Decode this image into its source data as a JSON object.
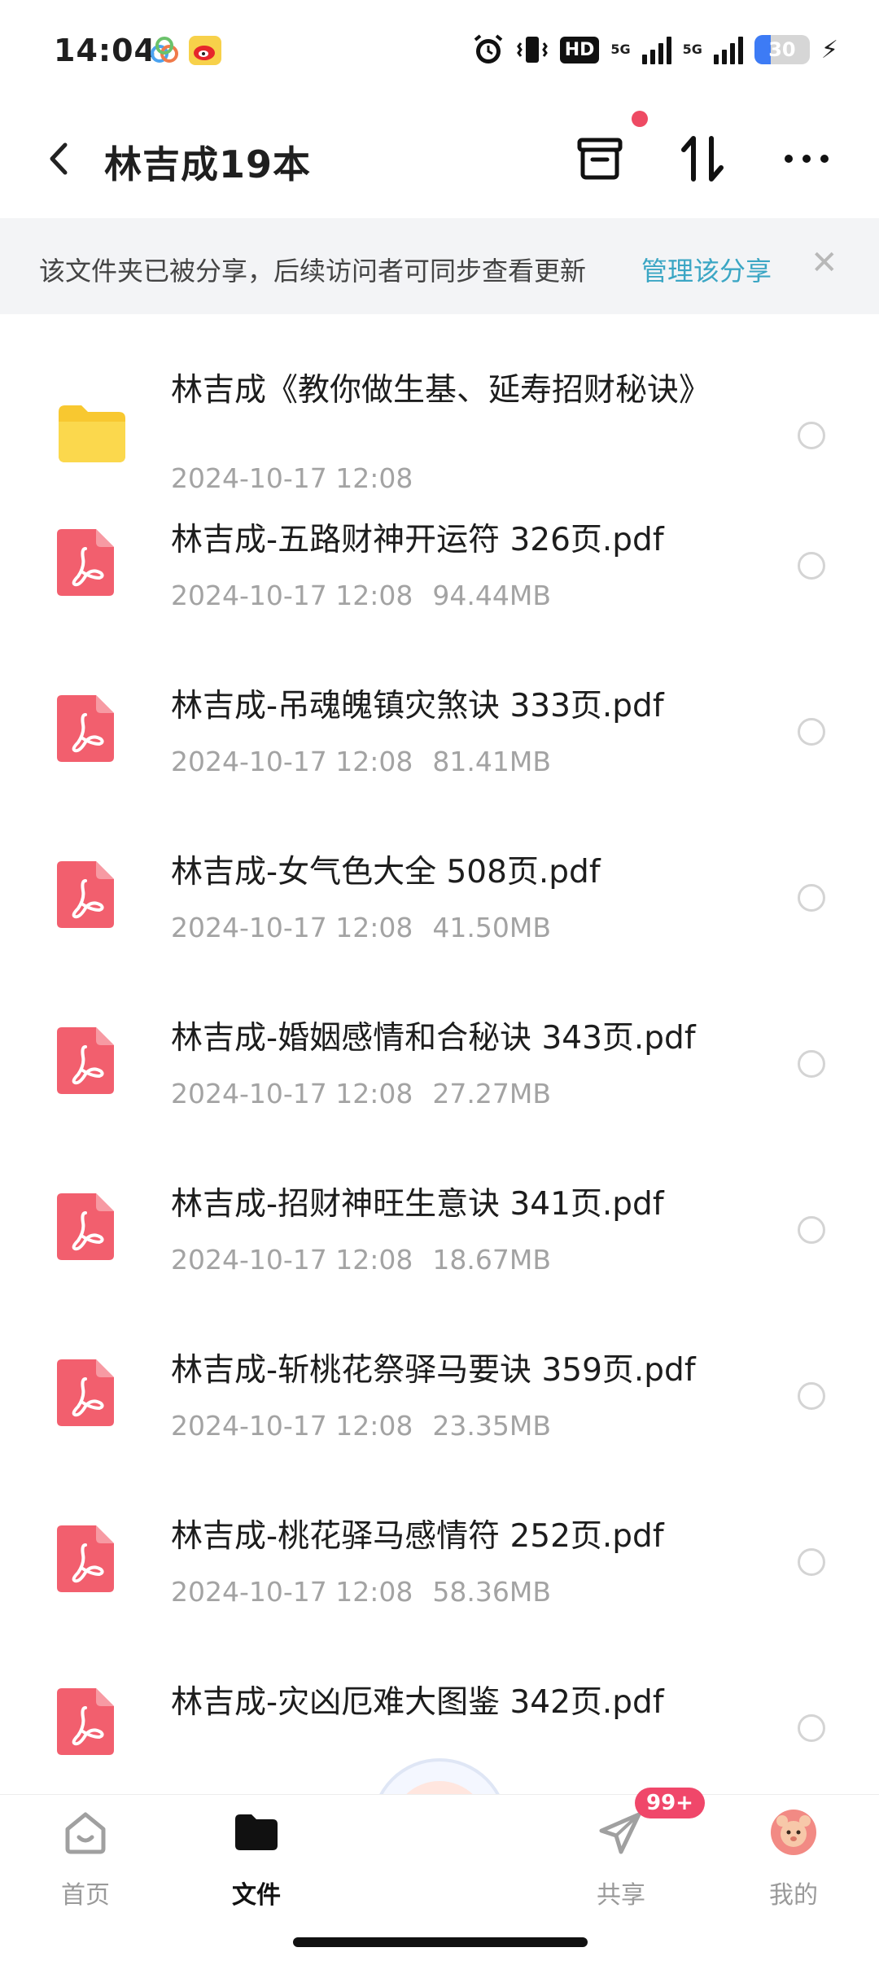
{
  "status_bar": {
    "time": "14:04",
    "hd_label": "HD",
    "net1": "5G",
    "net2": "5G",
    "battery_level": "30",
    "icons": [
      "cloud-app-icon",
      "weibo-icon",
      "alarm-icon",
      "vibrate-icon",
      "signal-icon",
      "battery-icon",
      "charging-icon"
    ]
  },
  "header": {
    "title": "林吉成19本",
    "icons": [
      "back-icon",
      "archive-icon",
      "sort-icon",
      "more-icon"
    ]
  },
  "banner": {
    "text": "该文件夹已被分享，后续访问者可同步查看更新",
    "link": "管理该分享",
    "close": "✕"
  },
  "files": [
    {
      "type": "folder",
      "name": "林吉成《教你做生基、延寿招财秘诀》",
      "date": "2024-10-17  12:08",
      "size": ""
    },
    {
      "type": "pdf",
      "name": "林吉成-五路财神开运符 326页.pdf",
      "date": "2024-10-17  12:08",
      "size": "94.44MB"
    },
    {
      "type": "pdf",
      "name": "林吉成-吊魂魄镇灾煞诀 333页.pdf",
      "date": "2024-10-17  12:08",
      "size": "81.41MB"
    },
    {
      "type": "pdf",
      "name": "林吉成-女气色大全 508页.pdf",
      "date": "2024-10-17  12:08",
      "size": "41.50MB"
    },
    {
      "type": "pdf",
      "name": "林吉成-婚姻感情和合秘诀 343页.pdf",
      "date": "2024-10-17  12:08",
      "size": "27.27MB"
    },
    {
      "type": "pdf",
      "name": "林吉成-招财神旺生意诀 341页.pdf",
      "date": "2024-10-17  12:08",
      "size": "18.67MB"
    },
    {
      "type": "pdf",
      "name": "林吉成-斩桃花祭驿马要诀 359页.pdf",
      "date": "2024-10-17  12:08",
      "size": "23.35MB"
    },
    {
      "type": "pdf",
      "name": "林吉成-桃花驿马感情符 252页.pdf",
      "date": "2024-10-17  12:08",
      "size": "58.36MB"
    },
    {
      "type": "pdf",
      "name": "林吉成-灾凶厄难大图鉴 342页.pdf",
      "date": "",
      "size": ""
    }
  ],
  "tabbar": {
    "tabs": [
      {
        "label": "首页",
        "icon": "home-icon",
        "active": false
      },
      {
        "label": "文件",
        "icon": "folder-icon",
        "active": true
      },
      {
        "label": "共享",
        "icon": "paper-plane-icon",
        "active": false
      },
      {
        "label": "我的",
        "icon": "avatar-icon",
        "active": false
      }
    ],
    "share_badge": "99+",
    "colors": {
      "accent": "#3ba6c4",
      "pdf_red": "#f25f6e",
      "folder_yellow": "#f8c830",
      "badge": "#f0476a"
    }
  }
}
